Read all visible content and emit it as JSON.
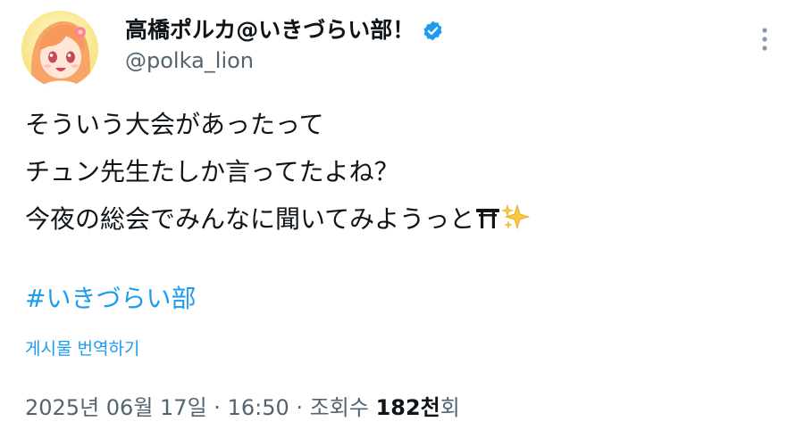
{
  "author": {
    "display_name": "高橋ポルカ@いきづらい部！",
    "handle": "@polka_lion",
    "verified_icon": "verified-badge-icon"
  },
  "tweet": {
    "lines": [
      "そういう大会があったって",
      "チュン先生たしか言ってたよね？",
      "今夜の総会でみんなに聞いてみようっと"
    ],
    "emoji": [
      "torii-emoji",
      "sparkles-emoji"
    ],
    "hashtag": "#いきづらい部",
    "translate_label": "게시물 번역하기"
  },
  "meta": {
    "date": "2025년 06월 17일",
    "separator": "·",
    "time": "16:50",
    "views_prefix": "조회수",
    "views_count": "182천",
    "views_suffix": "회"
  },
  "colors": {
    "text": "#0f1419",
    "secondary": "#536471",
    "link": "#1d9bf0",
    "background": "#ffffff"
  },
  "icons": {
    "more": "more-vertical-icon"
  }
}
